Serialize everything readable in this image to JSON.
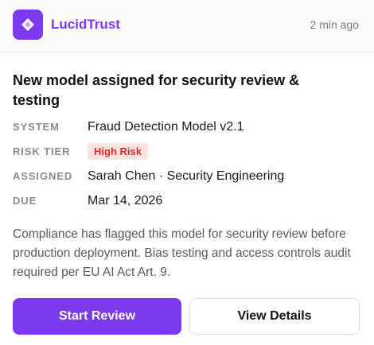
{
  "header": {
    "app_name": "LucidTrust",
    "logo_icon": "diamond-icon",
    "timestamp": "2 min ago"
  },
  "notification": {
    "title": "New model assigned for security review & testing",
    "fields": [
      {
        "label": "SYSTEM",
        "value": "Fraud Detection Model v2.1"
      },
      {
        "label": "RISK TIER",
        "value": "High Risk"
      },
      {
        "label": "ASSIGNED",
        "value": "Sarah Chen · Security Engineering"
      },
      {
        "label": "DUE",
        "value": "Mar 14, 2026"
      }
    ],
    "description": "Compliance has flagged this model for security review before production deployment. Bias testing and access controls audit required per EU AI Act Art. 9."
  },
  "actions": {
    "primary_label": "Start Review",
    "secondary_label": "View Details"
  },
  "colors": {
    "accent": "#7c3aed",
    "risk_badge_bg": "#fde2e2",
    "risk_badge_text": "#d22b2b"
  }
}
